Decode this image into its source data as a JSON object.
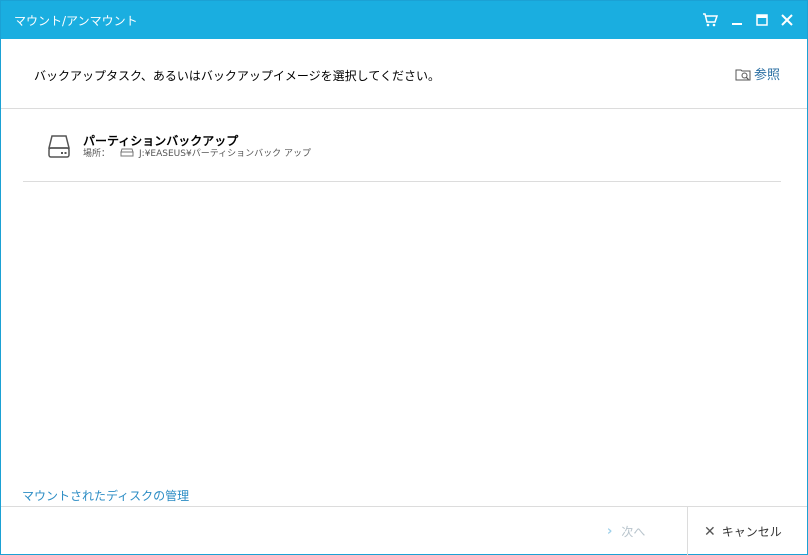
{
  "window": {
    "title": "マウント/アンマウント"
  },
  "titlebar_icons": {
    "cart": "cart-icon",
    "minimize": "minimize-icon",
    "maximize": "maximize-icon",
    "close": "close-icon"
  },
  "header": {
    "prompt": "バックアップタスク、あるいはバックアップイメージを選択してください。",
    "browse_label": "参照"
  },
  "backup_list": [
    {
      "name": "パーティションバックアップ",
      "location_label": "場所：",
      "location_path": "J:¥EASEUS¥パーティションバック アップ"
    }
  ],
  "links": {
    "manage_mounted": "マウントされたディスクの管理"
  },
  "footer": {
    "next_label": "次へ",
    "cancel_label": "キャンセル"
  },
  "colors": {
    "titlebar": "#1aaee0",
    "link": "#2b8cc4",
    "browse": "#2b6fa3"
  }
}
